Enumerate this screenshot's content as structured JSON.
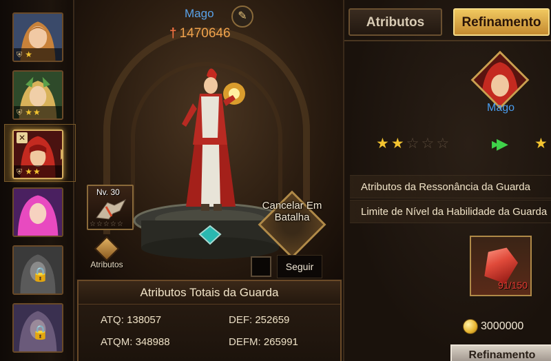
{
  "hero_list": {
    "slots": [
      {
        "stars": "★",
        "locked": false
      },
      {
        "stars": "★★",
        "locked": false
      },
      {
        "stars": "★★",
        "locked": false,
        "selected": true
      },
      {
        "stars": "",
        "locked": false
      },
      {
        "stars": "",
        "locked": true
      },
      {
        "stars": "",
        "locked": true
      }
    ]
  },
  "showcase": {
    "hero_name": "Mago",
    "power": "1470646",
    "mount_level": "Nv. 30",
    "mount_stars": "☆☆☆☆☆",
    "attributes_button": "Atributos",
    "cancel_button": "Cancelar Em Batalha",
    "follow_button": "Seguir"
  },
  "total_attributes": {
    "title": "Atributos Totais da Guarda",
    "stats": [
      {
        "label": "ATQ:",
        "value": "138057"
      },
      {
        "label": "DEF:",
        "value": "252659"
      },
      {
        "label": "ATQM:",
        "value": "348988"
      },
      {
        "label": "DEFM:",
        "value": "265991"
      }
    ]
  },
  "refine_panel": {
    "tabs": {
      "attributes": "Atributos",
      "refine": "Refinamento"
    },
    "hero_name": "Mago",
    "current_stars": 2,
    "max_stars": 5,
    "rows": [
      "Atributos da Ressonância da Guarda",
      "Limite de Nível da Habilidade da Guarda"
    ],
    "material_count": "91/150",
    "cost": "3000000",
    "refine_button": "Refinamento"
  },
  "colors": {
    "star": "#f4c430",
    "name_blue": "#4a9ef0",
    "power_orange": "#f0a24c",
    "accent_gold": "#d8b061"
  }
}
